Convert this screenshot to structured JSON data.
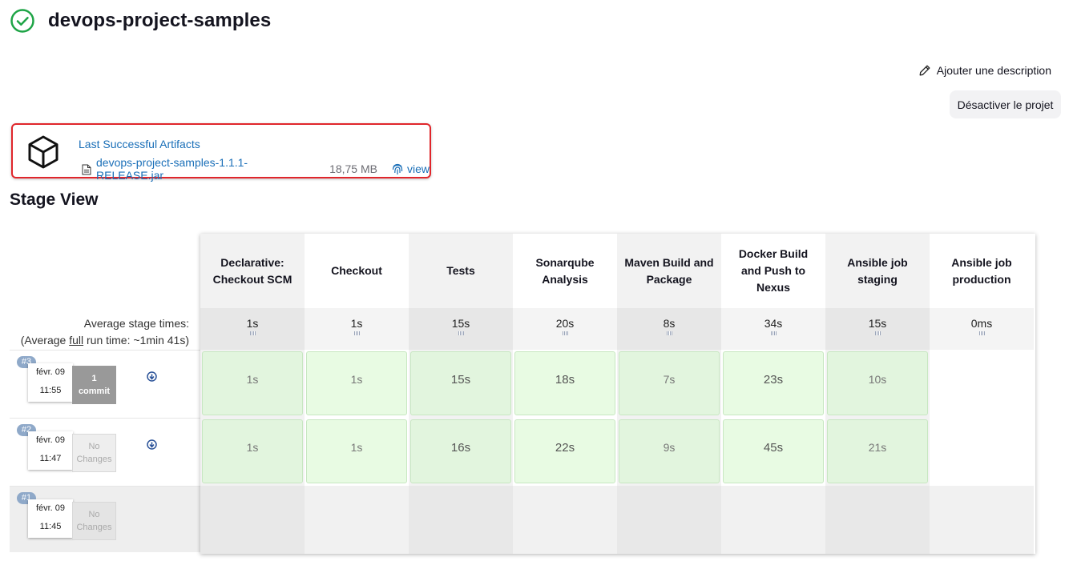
{
  "job": {
    "title": "devops-project-samples",
    "status": "success",
    "status_color": "#1ea446"
  },
  "actions": {
    "add_description": "Ajouter une description",
    "disable_project": "Désactiver le projet"
  },
  "artifacts": {
    "title": "Last Successful Artifacts",
    "file_name": "devops-project-samples-1.1.1-RELEASE.jar",
    "file_size": "18,75 MB",
    "view_label": "view",
    "highlight_color": "#e0262b"
  },
  "stage_view": {
    "title": "Stage View",
    "avg_label_line1": "Average stage times:",
    "avg_label_prefix": "(Average ",
    "avg_label_full": "full",
    "avg_label_suffix": " run time: ~1min 41s)",
    "stages": [
      {
        "name": "Declarative: Checkout SCM",
        "avg": "1s"
      },
      {
        "name": "Checkout",
        "avg": "1s"
      },
      {
        "name": "Tests",
        "avg": "15s"
      },
      {
        "name": "Sonarqube Analysis",
        "avg": "20s"
      },
      {
        "name": "Maven Build and Package",
        "avg": "8s"
      },
      {
        "name": "Docker Build and Push to Nexus",
        "avg": "34s"
      },
      {
        "name": "Ansible job staging",
        "avg": "15s"
      },
      {
        "name": "Ansible job production",
        "avg": "0ms"
      }
    ],
    "builds": [
      {
        "number": "#3",
        "date": "févr. 09",
        "time": "11:55",
        "changes_line1": "1",
        "changes_line2": "commit",
        "stage_times": [
          "1s",
          "1s",
          "15s",
          "18s",
          "7s",
          "23s",
          "10s",
          ""
        ]
      },
      {
        "number": "#2",
        "date": "févr. 09",
        "time": "11:47",
        "changes_line1": "No",
        "changes_line2": "Changes",
        "stage_times": [
          "1s",
          "1s",
          "16s",
          "22s",
          "9s",
          "45s",
          "21s",
          ""
        ]
      },
      {
        "number": "#1",
        "date": "févr. 09",
        "time": "11:45",
        "changes_line1": "No",
        "changes_line2": "Changes",
        "stage_times": [
          "",
          "",
          "",
          "",
          "",
          "",
          "",
          ""
        ]
      }
    ],
    "success_color": "#e2f5de"
  }
}
